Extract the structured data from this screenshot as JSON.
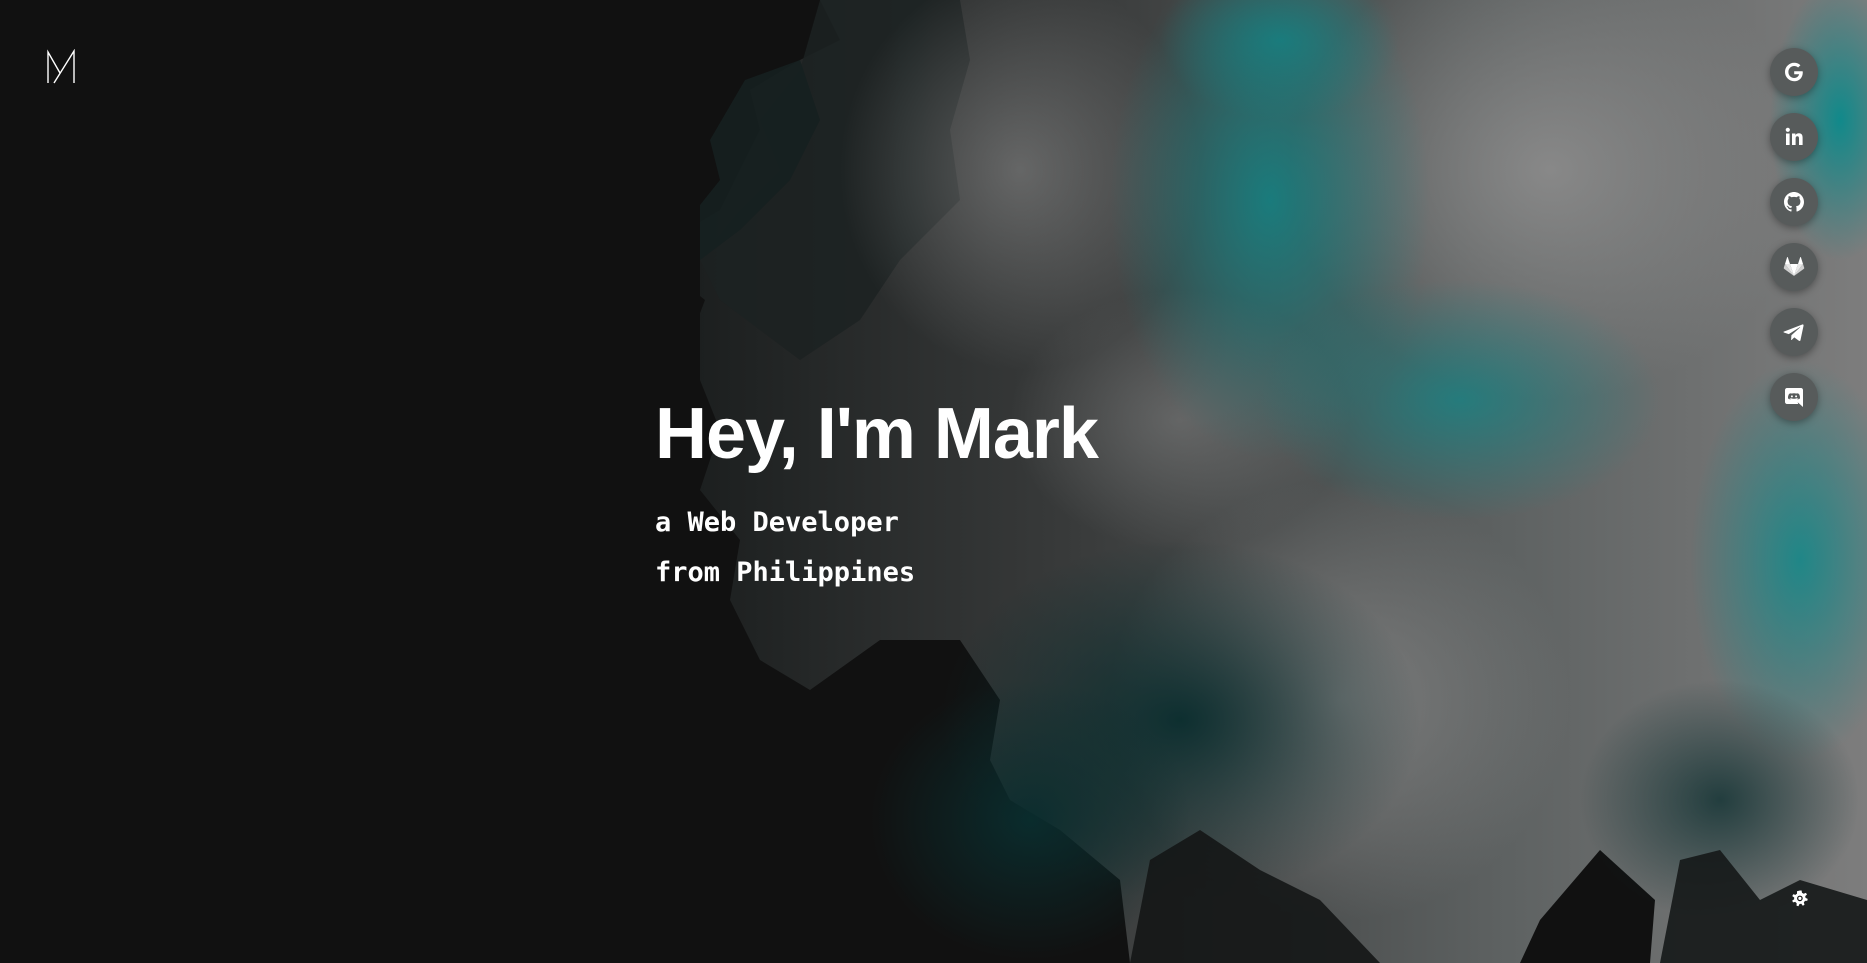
{
  "brand": {
    "logo_icon": "m-monogram-icon"
  },
  "hero": {
    "title": "Hey, I'm Mark",
    "subtitle_line1": "a Web Developer",
    "subtitle_line2": "from Philippines"
  },
  "social_links": [
    {
      "name": "Google",
      "icon": "google-icon"
    },
    {
      "name": "LinkedIn",
      "icon": "linkedin-icon"
    },
    {
      "name": "GitHub",
      "icon": "github-icon"
    },
    {
      "name": "GitLab",
      "icon": "gitlab-icon"
    },
    {
      "name": "Telegram",
      "icon": "telegram-icon"
    },
    {
      "name": "Discord",
      "icon": "discord-icon"
    }
  ],
  "settings": {
    "icon": "gear-icon"
  },
  "colors": {
    "background": "#111111",
    "accent_teal": "#0a7f80",
    "smoke_gray": "#7d7d7d",
    "text": "#ffffff",
    "icon_button_bg": "#575b5b"
  }
}
